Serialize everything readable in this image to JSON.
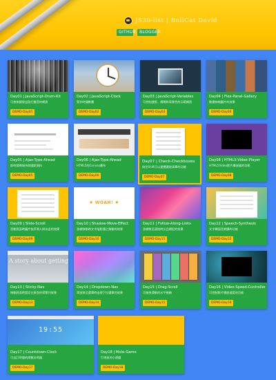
{
  "header": {
    "site_title": "JS30-list | BullCat David",
    "buttons": {
      "github": "GITHUB",
      "blogger": "BLOGGER"
    }
  },
  "thumbs": {
    "day10_text": "✸ WOAH! ✸",
    "day13_text": "A story about getting lost",
    "day17_time": "19:55"
  },
  "cards": [
    {
      "title": "Day01 | JavaScript-Drum-Kit",
      "desc": "可按按鍵發出敲打聲音的網頁",
      "button": "DEMO-Day01"
    },
    {
      "title": "Day02 | JavaScript-Clock",
      "desc": "實作時鐘動畫",
      "button": "DEMO-Day02"
    },
    {
      "title": "Day03 | JavaScript-Variables",
      "desc": "可控制邊框、模糊與背景色的示範網頁",
      "button": "DEMO-Day03"
    },
    {
      "title": "Day04 | Flex-Panel-Gallery",
      "desc": "動畫伸縮圖片的效果",
      "button": "DEMO-Day04"
    },
    {
      "title": "Day05 | Ajax-Type-Ahead",
      "desc": "即時搜尋城市與國家資料",
      "button": "DEMO-Day05"
    },
    {
      "title": "Day06 | Ajax-Type-Ahead",
      "desc": "HTML5的Canvas畫布",
      "button": "DEMO-Day06"
    },
    {
      "title": "Day07 | Check-Checkboxes",
      "desc": "按住Shift可以連續選取清單的功能",
      "button": "DEMO-Day07"
    },
    {
      "title": "Day08 | HTML5-Video-Player",
      "desc": "HTML5Video影片播放器的功能",
      "button": "DEMO-Day08"
    },
    {
      "title": "Day09 | Slide-Scroll",
      "desc": "滾動頁面時圖片依序滑入與淡出的效果",
      "button": "DEMO-Day09"
    },
    {
      "title": "Day10 | Shadow-Move-Effect",
      "desc": "游標移動時文字陰影隨之移動的效果",
      "button": "DEMO-Day10"
    },
    {
      "title": "Day11 | Follow-Along-Links",
      "desc": "游標移至連結時反白標記的效果",
      "button": "DEMO-Day11"
    },
    {
      "title": "Day12 | Speech-Synthesis",
      "desc": "文字轉語音朗讀的功能",
      "button": "DEMO-Day12"
    },
    {
      "title": "Day13 | Sticky-Nav",
      "desc": "捲動頁面時固定在頁首的導覽列效果",
      "button": "DEMO-Day13"
    },
    {
      "title": "Day14 | Dropdown-Nav",
      "desc": "滑鼠移至選單時出現下拉選單的效果",
      "button": "DEMO-Day14"
    },
    {
      "title": "Day15 | Drag-Scroll",
      "desc": "可拖曳滑動的水平捲軸",
      "button": "DEMO-Day15"
    },
    {
      "title": "Day16 | Video-Speed-Controller",
      "desc": "可控制影片播放速度的功能",
      "button": "DEMO-Day16"
    },
    {
      "title": "Day17 | Countdown-Clock",
      "desc": "可自訂時間的倒數計時器",
      "button": "DEMO-Day17"
    },
    {
      "title": "Day18 | Mole-Game",
      "desc": "打地鼠的小遊戲",
      "button": "DEMO-Day18"
    }
  ]
}
